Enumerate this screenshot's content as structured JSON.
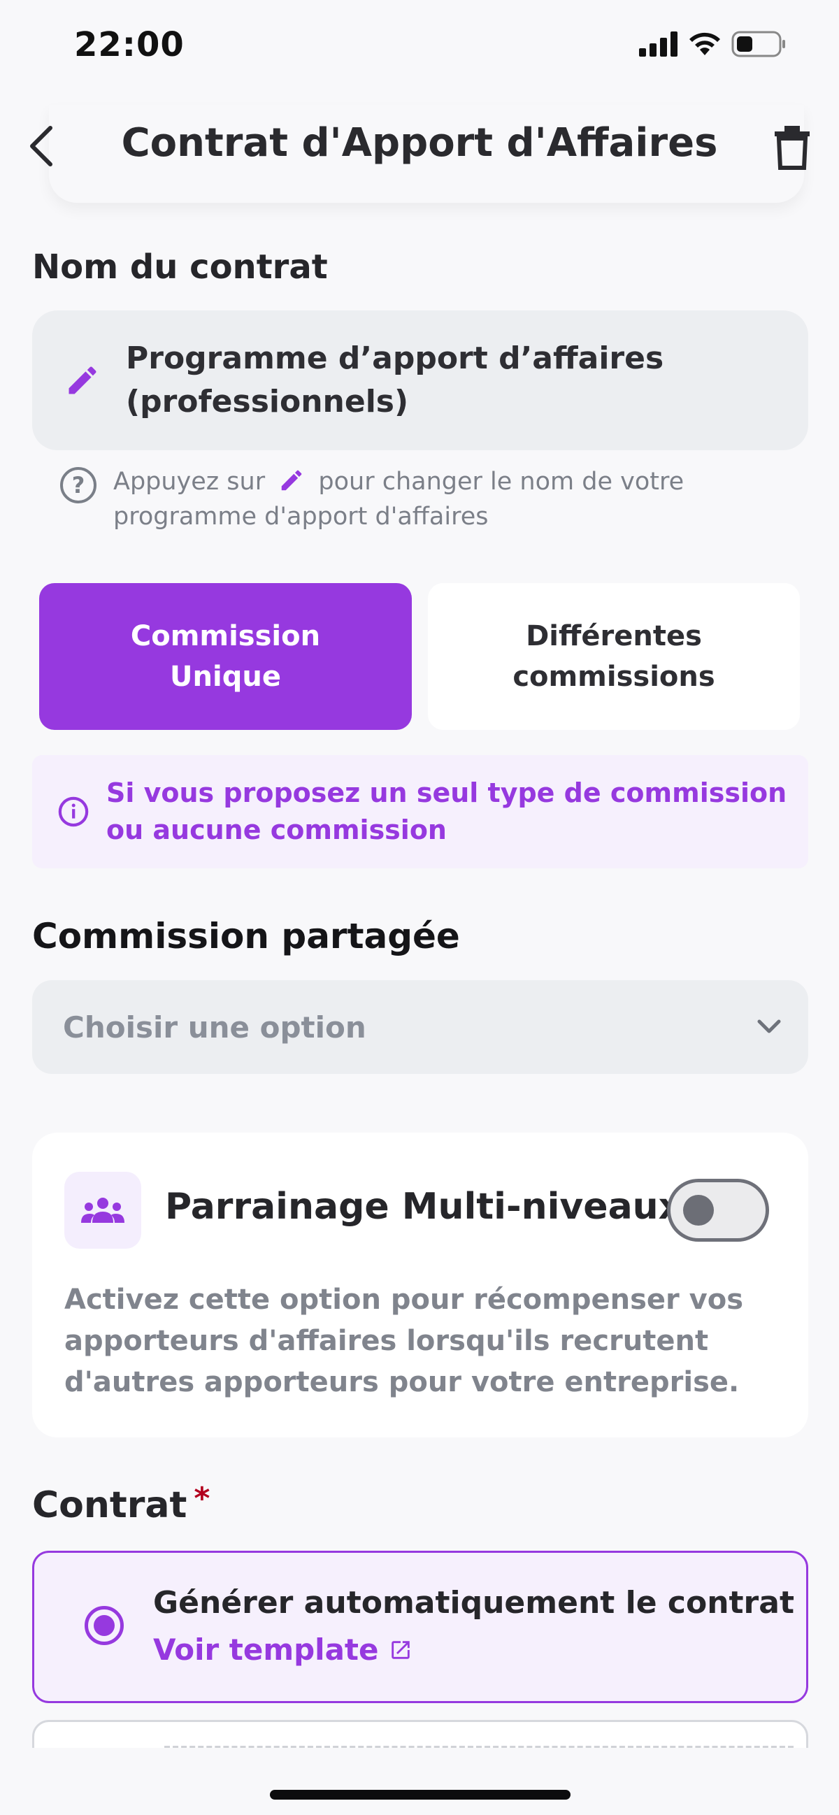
{
  "status_bar": {
    "time": "22:00"
  },
  "header": {
    "title": "Contrat d'Apport d'Affaires"
  },
  "contract_name": {
    "label": "Nom du contrat",
    "value": "Programme d’apport d’affaires (professionnels)",
    "hint_before": "Appuyez sur",
    "hint_after": "pour changer le nom de votre programme d'apport d'affaires"
  },
  "commission_type": {
    "options": [
      "Commission Unique",
      "Différentes commissions"
    ],
    "selected": "Commission Unique",
    "info": "Si vous proposez un seul type de commission ou aucune commission"
  },
  "shared_commission": {
    "label": "Commission partagée",
    "placeholder": "Choisir une option"
  },
  "multi_level": {
    "title": "Parrainage Multi-niveaux",
    "enabled": false,
    "description": "Activez cette option pour récompenser vos apporteurs d'affaires lorsqu'ils recrutent d'autres apporteurs pour votre entreprise."
  },
  "contract": {
    "label": "Contrat",
    "required_mark": "*",
    "auto_generate_label": "Générer automatiquement le contrat",
    "template_link": "Voir template"
  },
  "colors": {
    "accent": "#9639df",
    "accent_light": "#f6f0fd",
    "field_bg": "#eceef1"
  },
  "icons": [
    "back-arrow-icon",
    "trash-icon",
    "pencil-icon",
    "question-icon",
    "info-icon",
    "chevron-down-icon",
    "people-group-icon",
    "external-link-icon"
  ]
}
